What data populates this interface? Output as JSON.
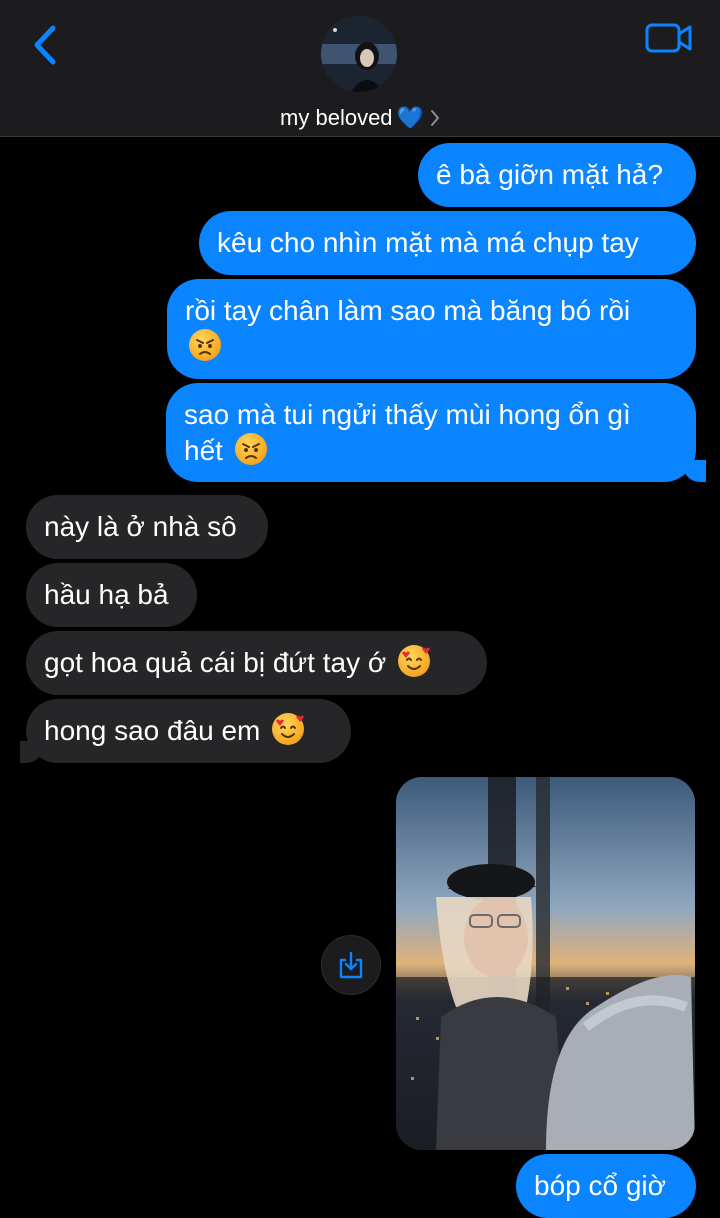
{
  "header": {
    "contact_name": "my beloved",
    "contact_emoji": "💙",
    "back_icon": "chevron-left-icon",
    "video_icon": "video-camera-icon",
    "accent_color": "#0b84ff"
  },
  "messages": {
    "out_1": "ê bà giỡn mặt hả?",
    "out_2": "kêu cho nhìn mặt mà má chụp tay",
    "out_3": "rồi tay chân làm sao mà băng bó rồi",
    "out_4_line1": "sao mà tui ngửi thấy mùi hong ổn gì",
    "out_4_line2": "hết",
    "in_1": "này là ở nhà sô",
    "in_2": "hầu hạ bả",
    "in_3": "gọt hoa quả cái bị đứt tay ớ",
    "in_4": "hong sao đâu em",
    "out_5": "bóp cổ giờ"
  },
  "colors": {
    "outgoing_bubble": "#0b84ff",
    "incoming_bubble": "#262628",
    "background": "#000000",
    "header_bg": "#1c1c1e"
  }
}
